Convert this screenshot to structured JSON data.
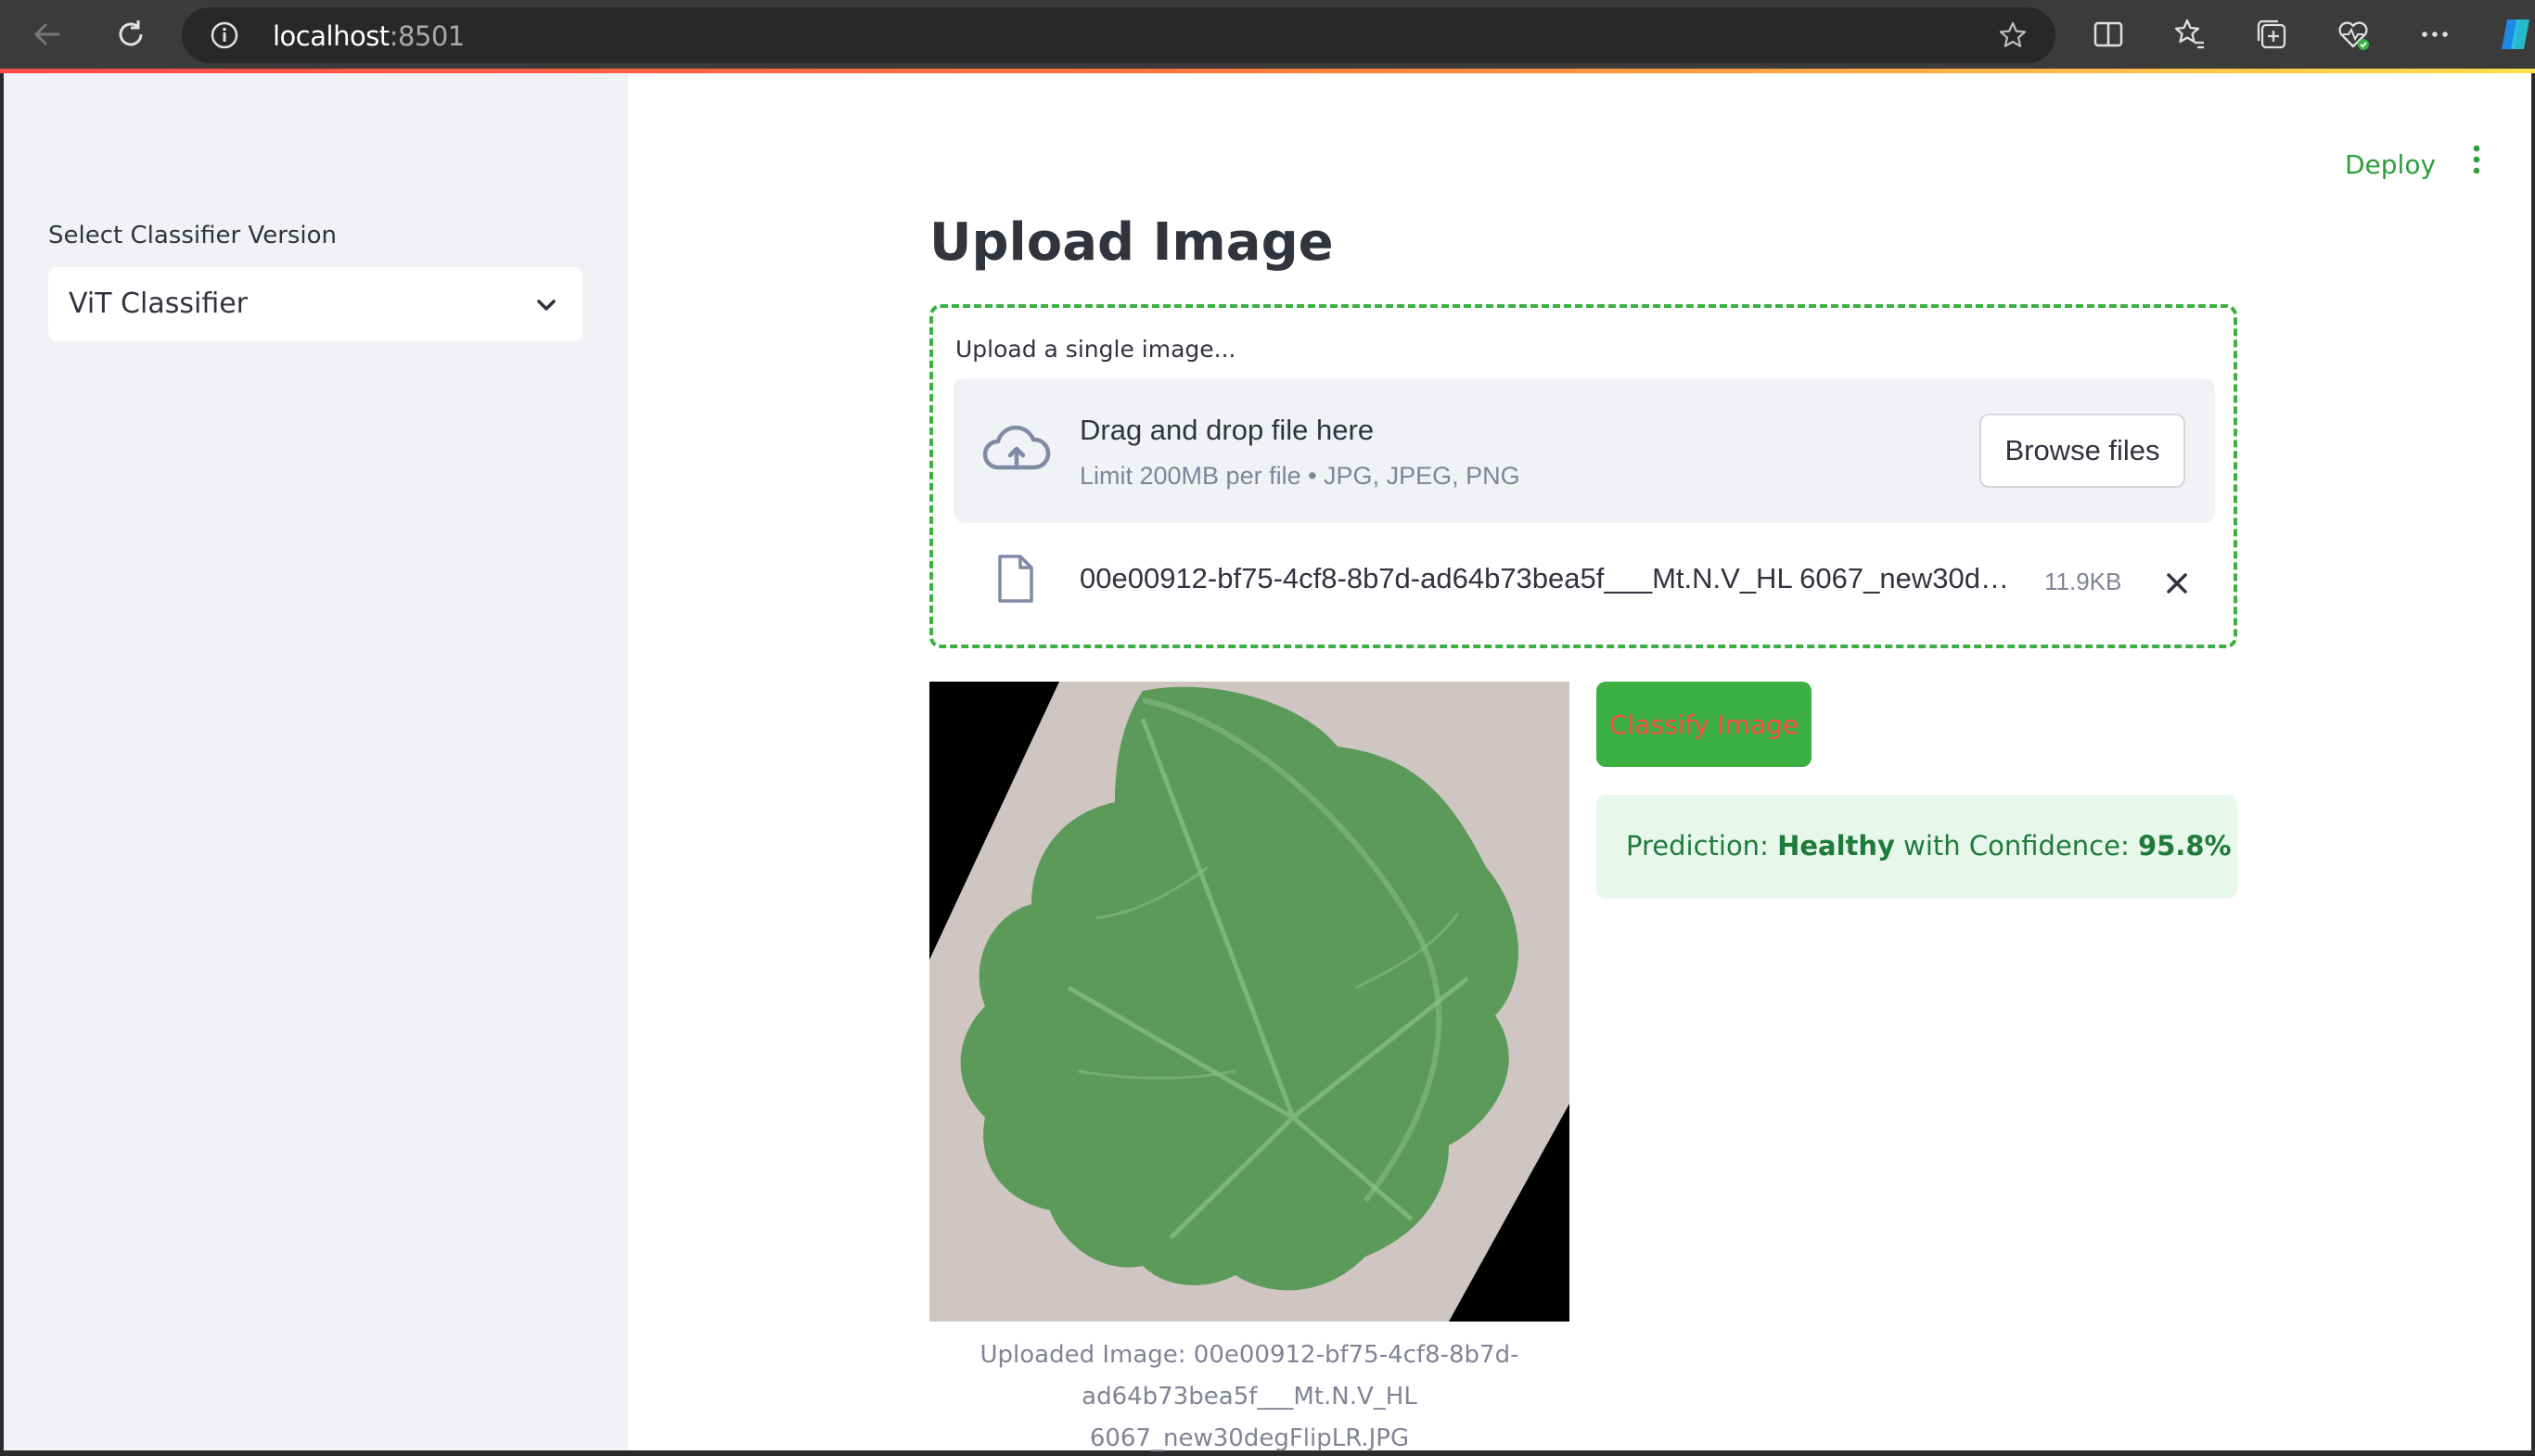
{
  "browser": {
    "url_host": "localhost",
    "url_port": ":8501"
  },
  "sidebar": {
    "select_label": "Select Classifier Version",
    "select_value": "ViT Classifier"
  },
  "header": {
    "deploy_label": "Deploy"
  },
  "main": {
    "title": "Upload Image",
    "uploader": {
      "label": "Upload a single image...",
      "drop_title": "Drag and drop file here",
      "drop_sub": "Limit 200MB per file • JPG, JPEG, PNG",
      "browse_label": "Browse files",
      "file_name": "00e00912-bf75-4cf8-8b7d-ad64b73bea5f___Mt.N.V_HL 6067_new30d…",
      "file_size": "11.9KB"
    },
    "image_caption_line1": "Uploaded Image: 00e00912-bf75-4cf8-8b7d-",
    "image_caption_line2": "ad64b73bea5f___Mt.N.V_HL 6067_new30degFlipLR.JPG",
    "classify_label": "Classify Image",
    "result": {
      "prefix": "Prediction: ",
      "label": "Healthy",
      "middle": " with Confidence: ",
      "confidence": "95.8%"
    }
  },
  "colors": {
    "accent_green": "#3cb043",
    "deploy_green": "#2e9e3c",
    "danger_red": "#ff4b4b",
    "success_bg": "#e8f7ec",
    "success_text": "#1e7b3a",
    "sidebar_bg": "#f0f2f6"
  },
  "icons": [
    "back-arrow-icon",
    "reload-icon",
    "info-icon",
    "star-icon",
    "split-screen-icon",
    "favorites-icon",
    "collections-icon",
    "health-icon",
    "more-icon",
    "copilot-icon",
    "chevron-down-icon",
    "kebab-menu-icon",
    "cloud-upload-icon",
    "file-icon",
    "close-icon"
  ]
}
